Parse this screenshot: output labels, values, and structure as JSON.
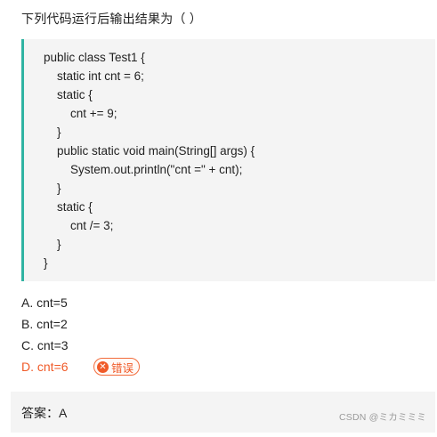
{
  "question": {
    "stem": "下列代码运行后输出结果为（ ）",
    "code_lines": [
      "public class Test1 {",
      "static int cnt = 6;",
      "static {",
      "cnt += 9;",
      "}",
      "public static void main(String[] args) {",
      "System.out.println(\"cnt =\" + cnt);",
      "}",
      "static {",
      "cnt /= 3;",
      "}",
      "}"
    ]
  },
  "options": [
    {
      "label": "A. cnt=5"
    },
    {
      "label": "B. cnt=2"
    },
    {
      "label": "C. cnt=3"
    },
    {
      "label": "D. cnt=6",
      "status": "wrong"
    }
  ],
  "wrong_badge": {
    "icon": "x-circle-icon",
    "label": "错误"
  },
  "answer": {
    "text": "答案：A"
  },
  "watermark": "CSDN @ミカミミミ",
  "colors": {
    "accent_bar": "#2fb3a2",
    "wrong": "#f05a28",
    "panel_bg": "#f4f4f4"
  }
}
